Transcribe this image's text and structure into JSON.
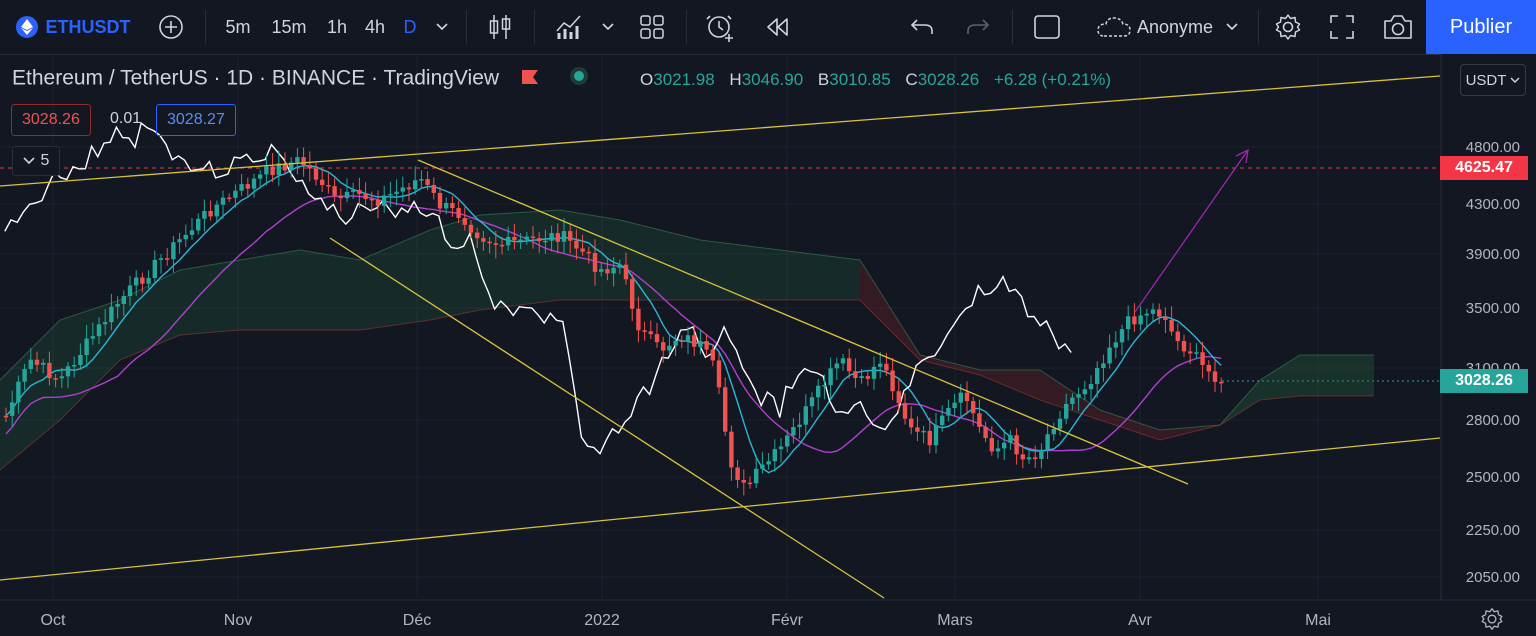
{
  "toolbar": {
    "symbol": "ETHUSDT",
    "intervals": [
      "5m",
      "15m",
      "1h",
      "4h",
      "D"
    ],
    "active_interval": "D",
    "layout_name": "Anonyme",
    "publish_label": "Publier"
  },
  "legend": {
    "title": "Ethereum / TetherUS · 1D · BINANCE · TradingView",
    "open_label": "O",
    "open": "3021.98",
    "high_label": "H",
    "high": "3046.90",
    "low_label": "B",
    "low": "3010.85",
    "close_label": "C",
    "close": "3028.26",
    "change": "+6.28 (+0.21%)",
    "sell_price": "3028.26",
    "spread": "0.01",
    "buy_price": "3028.27",
    "indicators_count": "5"
  },
  "price_axis": {
    "currency": "USDT",
    "ticks": [
      "4800.00",
      "4300.00",
      "3900.00",
      "3500.00",
      "3100.00",
      "2800.00",
      "2500.00",
      "2250.00",
      "2050.00"
    ],
    "alert_level": "4625.47",
    "last_price": "3028.26"
  },
  "time_axis": {
    "labels": [
      "Oct",
      "Nov",
      "Déc",
      "2022",
      "Févr",
      "Mars",
      "Avr",
      "Mai"
    ]
  },
  "colors": {
    "background": "#131722",
    "up": "#26a69a",
    "down": "#ef5350",
    "trendline": "#d8c33a",
    "projection": "#9c27b0",
    "tenkan": "#2bb6d8",
    "kijun": "#b03fd0",
    "lagging": "#ffffff",
    "accent": "#2962ff"
  },
  "icons": [
    "add-symbol-icon",
    "chevron-down-icon",
    "candles-icon",
    "indicators-icon",
    "templates-icon",
    "alert-icon",
    "replay-icon",
    "undo-icon",
    "redo-icon",
    "layout-icon",
    "cloud-icon",
    "settings-icon",
    "fullscreen-icon",
    "camera-icon",
    "gear-icon"
  ]
}
